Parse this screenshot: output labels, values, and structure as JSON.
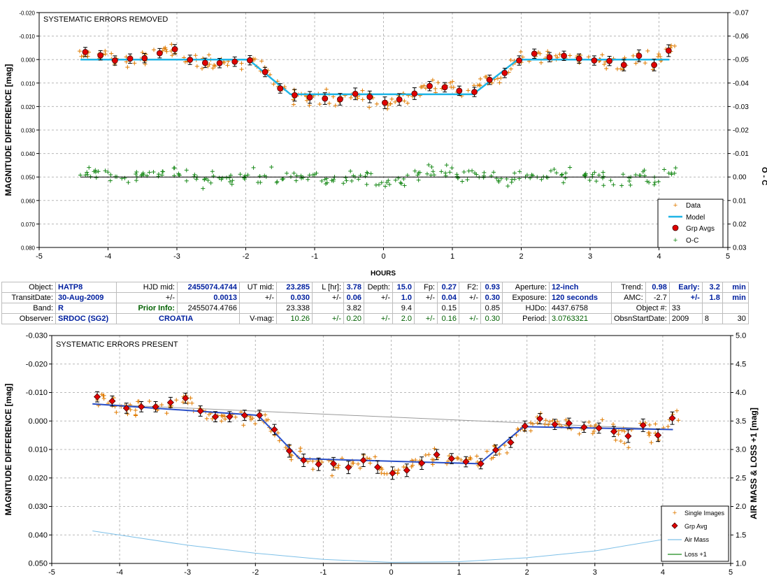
{
  "chart_data": [
    {
      "type": "scatter",
      "panel": "top",
      "title": "SYSTEMATIC ERRORS REMOVED",
      "xlabel": "HOURS",
      "ylabel": "MAGNITUDE DIFFERENCE [mag]",
      "y2label": "O - C",
      "xlim": [
        -5,
        5
      ],
      "ylim": [
        0.08,
        -0.02
      ],
      "y2lim": [
        0.03,
        -0.07
      ],
      "x_ticks": [
        "-5",
        "-4",
        "-3",
        "-2",
        "-1",
        "0",
        "1",
        "2",
        "3",
        "4",
        "5"
      ],
      "y_ticks": [
        "-0.020",
        "-0.010",
        "0.000",
        "0.010",
        "0.020",
        "0.030",
        "0.040",
        "0.050",
        "0.060",
        "0.070",
        "0.080"
      ],
      "y2_ticks": [
        "-0.07",
        "-0.06",
        "-0.05",
        "-0.04",
        "-0.03",
        "-0.02",
        "-0.01",
        "0.00",
        "0.01",
        "0.02",
        "0.03"
      ],
      "grid": true,
      "legend": {
        "position": "bottom-right",
        "entries": [
          "Data",
          "Model",
          "Grp Avgs",
          "O-C"
        ]
      },
      "colors": {
        "data": "#e07b00",
        "model": "#1eb4e6",
        "grp": "#e00000",
        "oc": "#1a8a1a",
        "zero": "#000000"
      },
      "model": {
        "x": [
          -4.4,
          -1.96,
          -1.35,
          1.3,
          1.95,
          4.15
        ],
        "y": [
          0.0,
          0.0,
          0.0148,
          0.0148,
          0.0,
          0.0
        ]
      },
      "oc_zero": {
        "x": [
          -4.4,
          4.15
        ],
        "y": [
          0.0,
          0.0
        ]
      },
      "grp_avgs": {
        "x": [
          -4.33,
          -4.11,
          -3.9,
          -3.68,
          -3.47,
          -3.25,
          -3.03,
          -2.81,
          -2.59,
          -2.38,
          -2.16,
          -1.94,
          -1.72,
          -1.5,
          -1.29,
          -1.07,
          -0.85,
          -0.63,
          -0.41,
          -0.2,
          0.02,
          0.23,
          0.45,
          0.67,
          0.89,
          1.1,
          1.32,
          1.54,
          1.76,
          1.97,
          2.19,
          2.41,
          2.62,
          2.84,
          3.06,
          3.28,
          3.49,
          3.71,
          3.93,
          4.14
        ],
        "y": [
          -0.0032,
          -0.0018,
          0.0004,
          -0.0004,
          -0.0006,
          -0.0027,
          -0.0044,
          0.0001,
          0.0014,
          0.0015,
          0.0009,
          0.0003,
          0.0053,
          0.0123,
          0.0152,
          0.0161,
          0.0166,
          0.0169,
          0.0146,
          0.0159,
          0.0184,
          0.017,
          0.0145,
          0.0113,
          0.0118,
          0.0133,
          0.0138,
          0.0086,
          0.0057,
          0.0004,
          -0.0025,
          -0.001,
          -0.0016,
          -0.0004,
          0.0004,
          0.0006,
          0.0023,
          -0.0016,
          0.0023,
          -0.0038
        ],
        "err": [
          0.002,
          0.002,
          0.002,
          0.002,
          0.002,
          0.002,
          0.002,
          0.002,
          0.002,
          0.002,
          0.002,
          0.002,
          0.002,
          0.002,
          0.0025,
          0.0025,
          0.0025,
          0.0025,
          0.0025,
          0.0025,
          0.0025,
          0.0025,
          0.0025,
          0.002,
          0.002,
          0.002,
          0.002,
          0.002,
          0.002,
          0.002,
          0.002,
          0.002,
          0.002,
          0.002,
          0.002,
          0.002,
          0.0025,
          0.0025,
          0.0025,
          0.0025
        ]
      }
    },
    {
      "type": "scatter",
      "panel": "bottom",
      "title": "SYSTEMATIC ERRORS PRESENT",
      "xlabel": "",
      "ylabel": "MAGNITUDE DIFFERENCE [mag]",
      "y2label": "AIR MASS & LOSS +1 [mag]",
      "xlim": [
        -5,
        5
      ],
      "ylim": [
        0.05,
        -0.03
      ],
      "y2lim": [
        1.0,
        5.0
      ],
      "x_ticks": [
        "-5",
        "-4",
        "-3",
        "-2",
        "-1",
        "0",
        "1",
        "2",
        "3",
        "4",
        "5"
      ],
      "y_ticks": [
        "-0.030",
        "-0.020",
        "-0.010",
        "0.000",
        "0.010",
        "0.020",
        "0.030",
        "0.040",
        "0.050"
      ],
      "y2_ticks": [
        "5.0",
        "4.5",
        "4.0",
        "3.5",
        "3.0",
        "2.5",
        "2.0",
        "1.5",
        "1.0"
      ],
      "grid": true,
      "legend": {
        "position": "bottom-right",
        "entries": [
          "Single Images",
          "Grp Avg",
          "Air Mass",
          "Loss +1"
        ]
      },
      "colors": {
        "data": "#e07b00",
        "model": "#2a50c8",
        "grp": "#e00000",
        "trend": "#9a9a9a",
        "airmass": "#7ec0e8",
        "loss": "#1a8a1a"
      },
      "model": {
        "x": [
          -4.4,
          -1.96,
          -1.35,
          1.3,
          1.95,
          4.15
        ],
        "y": [
          -0.006,
          -0.002,
          0.0132,
          0.015,
          0.002,
          0.003
        ]
      },
      "trend": {
        "x": [
          -4.4,
          4.15
        ],
        "y": [
          -0.006,
          0.003
        ]
      },
      "airmass": {
        "x": [
          -4.4,
          -3.0,
          -2.0,
          -1.0,
          0.0,
          1.0,
          2.0,
          3.0,
          4.15
        ],
        "y": [
          1.57,
          1.32,
          1.18,
          1.07,
          1.02,
          1.03,
          1.1,
          1.22,
          1.45
        ]
      },
      "grp_avgs": {
        "x": [
          -4.33,
          -4.11,
          -3.9,
          -3.68,
          -3.47,
          -3.25,
          -3.03,
          -2.81,
          -2.59,
          -2.38,
          -2.16,
          -1.94,
          -1.72,
          -1.5,
          -1.29,
          -1.07,
          -0.85,
          -0.63,
          -0.41,
          -0.2,
          0.02,
          0.23,
          0.45,
          0.67,
          0.89,
          1.1,
          1.32,
          1.54,
          1.76,
          1.97,
          2.19,
          2.41,
          2.62,
          2.84,
          3.06,
          3.28,
          3.49,
          3.71,
          3.93,
          4.14
        ],
        "y": [
          -0.0085,
          -0.007,
          -0.0045,
          -0.005,
          -0.005,
          -0.0065,
          -0.008,
          -0.0035,
          -0.0015,
          -0.0015,
          -0.002,
          -0.002,
          0.003,
          0.0105,
          0.0138,
          0.0152,
          0.015,
          0.0163,
          0.0138,
          0.0162,
          0.0183,
          0.0173,
          0.0148,
          0.0118,
          0.0132,
          0.0143,
          0.015,
          0.0102,
          0.0075,
          0.0018,
          -0.0008,
          0.0012,
          0.0008,
          0.0022,
          0.0025,
          0.0037,
          0.0053,
          0.0015,
          0.005,
          -0.001
        ],
        "err": [
          0.0018,
          0.0018,
          0.0018,
          0.0018,
          0.0018,
          0.0018,
          0.0018,
          0.0018,
          0.0018,
          0.0018,
          0.0018,
          0.0018,
          0.0018,
          0.0022,
          0.0022,
          0.0022,
          0.0022,
          0.0022,
          0.0022,
          0.0022,
          0.0022,
          0.0022,
          0.0022,
          0.0018,
          0.0018,
          0.0018,
          0.0018,
          0.0018,
          0.0018,
          0.0018,
          0.0018,
          0.0018,
          0.0018,
          0.0018,
          0.0018,
          0.0018,
          0.0022,
          0.0022,
          0.0022,
          0.0022
        ]
      }
    }
  ],
  "info_table": {
    "object_lbl": "Object:",
    "object_val": "HATP8",
    "hjd_lbl": "HJD mid:",
    "hjd_val": "2455074.4744",
    "ut_lbl": "UT mid:",
    "ut_val": "23.285",
    "l_lbl": "L [hr]:",
    "l_val": "3.78",
    "depth_lbl": "Depth:",
    "depth_val": "15.0",
    "fp_lbl": "Fp:",
    "fp_val": "0.27",
    "f2_lbl": "F2:",
    "f2_val": "0.93",
    "aperture_lbl": "Aperture:",
    "aperture_val": "12-inch",
    "trend_lbl": "Trend:",
    "trend_val": "0.98",
    "early_lbl": "Early:",
    "early_val": "3.2",
    "early_unit": "min",
    "transit_lbl": "TransitDate:",
    "transit_val": "30-Aug-2009",
    "pm": "+/-",
    "hjd_err": "0.0013",
    "ut_err": "0.030",
    "l_err": "0.06",
    "depth_err": "1.0",
    "fp_err": "0.04",
    "f2_err": "0.30",
    "exposure_lbl": "Exposure:",
    "exposure_val": "120 seconds",
    "amc_lbl": "AMC:",
    "amc_val": "-2.7",
    "early_err": "1.8",
    "early_err_unit": "min",
    "band_lbl": "Band:",
    "band_val": "R",
    "prior_lbl": "Prior Info:",
    "prior_hjd": "2455074.4766",
    "prior_ut": "23.338",
    "prior_l": "3.82",
    "prior_depth": "9.4",
    "prior_fp": "0.15",
    "prior_f2": "0.85",
    "hjdo_lbl": "HJDo:",
    "hjdo_val": "4437.6758",
    "objnum_lbl": "Object #:",
    "objnum_val": "33",
    "observer_lbl": "Observer:",
    "observer_val": "SRDOC (SG2)",
    "country_val": "CROATIA",
    "vmag_lbl": "V-mag:",
    "vmag_val": "10.26",
    "vmag_err": "0.20",
    "depth_err2": "2.0",
    "fp_err2": "0.16",
    "f2_err2": "0.30",
    "period_lbl": "Period:",
    "period_val": "3.0763321",
    "obsn_lbl": "ObsnStartDate:",
    "obsn_y": "2009",
    "obsn_m": "8",
    "obsn_d": "30"
  }
}
